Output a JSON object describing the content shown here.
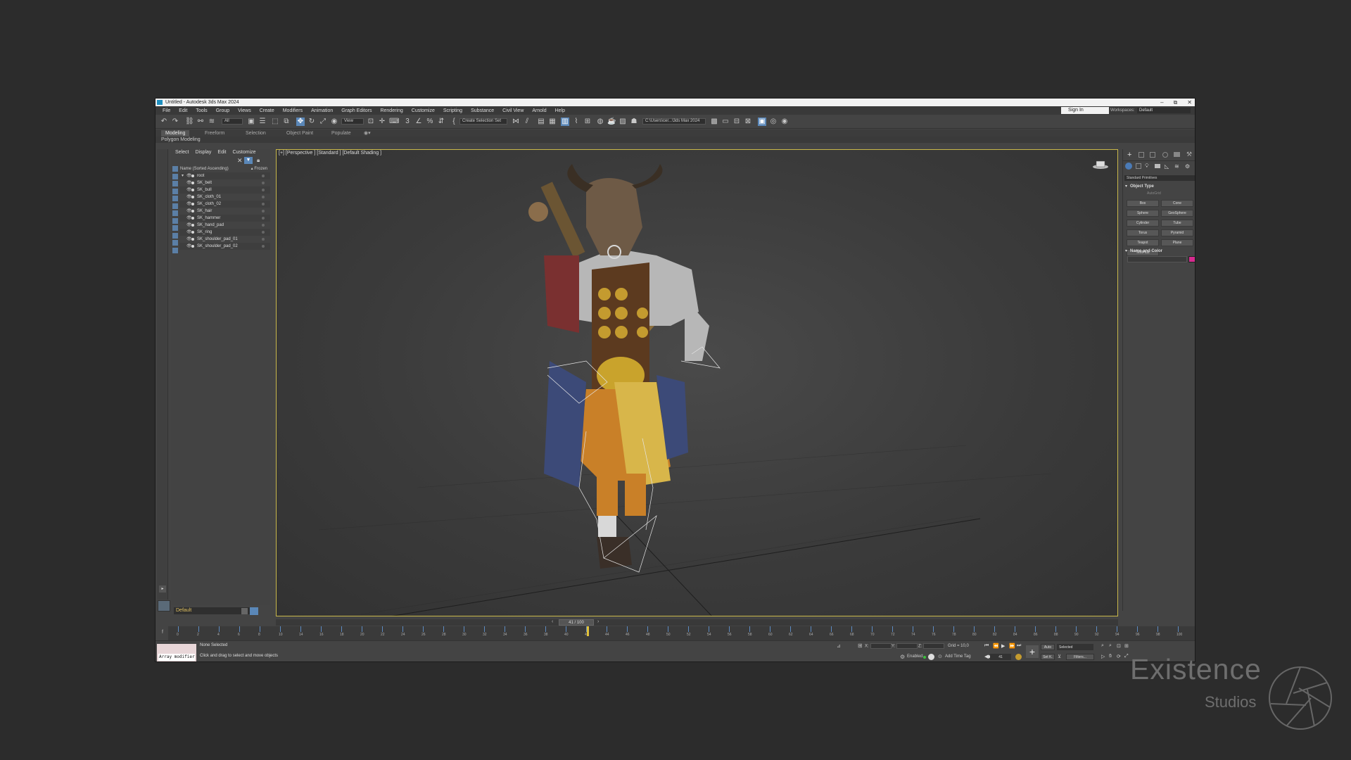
{
  "window": {
    "title": "Untitled - Autodesk 3ds Max 2024",
    "min": "–",
    "max": "⧉",
    "close": "✕"
  },
  "menu": [
    "File",
    "Edit",
    "Tools",
    "Group",
    "Views",
    "Create",
    "Modifiers",
    "Animation",
    "Graph Editors",
    "Rendering",
    "Customize",
    "Scripting",
    "Substance",
    "Civil View",
    "Arnold",
    "Help"
  ],
  "signin": "Sign In",
  "workspaces": {
    "label": "Workspaces:",
    "value": "Default"
  },
  "toolbar": {
    "filter_value": "All",
    "refcoord_value": "View",
    "selection_set": "Create Selection Set",
    "project_path": "C:\\Users\\cer...\\3ds Max 2024"
  },
  "ribbon": {
    "tabs": [
      "Modeling",
      "Freeform",
      "Selection",
      "Object Paint",
      "Populate"
    ],
    "active": "Modeling",
    "sub": "Polygon Modeling"
  },
  "scene_explorer": {
    "tabs": [
      "Select",
      "Display",
      "Edit",
      "Customize"
    ],
    "column_name": "Name (Sorted Ascending)",
    "column_frozen": "▴ Frozen",
    "rows": [
      {
        "name": "root",
        "expanded": true
      },
      {
        "name": "SK_belt"
      },
      {
        "name": "SK_bull"
      },
      {
        "name": "SK_cloth_01"
      },
      {
        "name": "SK_cloth_02"
      },
      {
        "name": "SK_hair"
      },
      {
        "name": "SK_hammer"
      },
      {
        "name": "SK_hand_pad"
      },
      {
        "name": "SK_ring"
      },
      {
        "name": "SK_shoulder_pad_01"
      },
      {
        "name": "SK_shoulder_pad_02"
      }
    ],
    "layer": "Default"
  },
  "viewport": {
    "label": "[+] [Perspective ] [Standard ] [Default Shading ]"
  },
  "command_panel": {
    "category": "Standard Primitives",
    "object_type_title": "Object Type",
    "autogrid": "AutoGrid",
    "primitives": [
      "Box",
      "Cone",
      "Sphere",
      "GeoSphere",
      "Cylinder",
      "Tube",
      "Torus",
      "Pyramid",
      "Teapot",
      "Plane",
      "TextPlus"
    ],
    "name_color_title": "Name and Color",
    "color": "#d72b8f"
  },
  "time": {
    "frame_display": "41 / 100",
    "current_frame": 41,
    "ticks": [
      "0",
      "2",
      "4",
      "6",
      "8",
      "10",
      "14",
      "16",
      "18",
      "20",
      "22",
      "24",
      "26",
      "28",
      "30",
      "32",
      "34",
      "36",
      "38",
      "40",
      "42",
      "44",
      "46",
      "48",
      "50",
      "52",
      "54",
      "56",
      "58",
      "60",
      "62",
      "64",
      "66",
      "68",
      "70",
      "72",
      "74",
      "76",
      "78",
      "80",
      "82",
      "84",
      "86",
      "88",
      "90",
      "92",
      "94",
      "96",
      "98",
      "100"
    ]
  },
  "status": {
    "maxscript_line": "Array modifier",
    "selection": "None Selected",
    "prompt": "Click and drag to select and move objects",
    "x_label": "X:",
    "y_label": "Y:",
    "z_label": "Z:",
    "x_val": "",
    "y_val": "",
    "z_val": "",
    "grid": "Grid = 10,0",
    "enabled": "Enabled:",
    "add_time_tag": "Add Time Tag",
    "auto": "Auto",
    "set_k": "Set K.",
    "selected": "Selected",
    "filters": "Filters...",
    "frame_field": "41"
  },
  "watermark": {
    "title": "Existence",
    "sub": "Studios"
  }
}
